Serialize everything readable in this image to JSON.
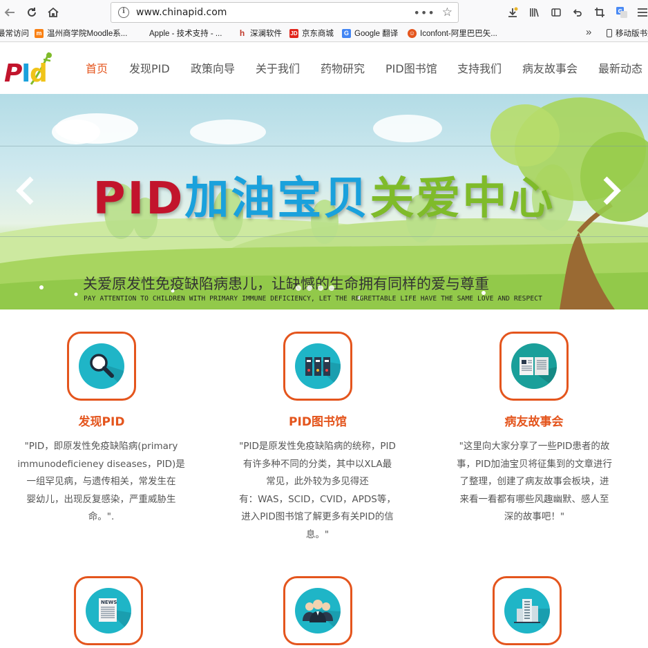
{
  "browser": {
    "url": "www.chinapid.com",
    "bookmarks": [
      {
        "label": "最常访问",
        "icon": "bookmark-star-icon"
      },
      {
        "label": "温州商学院Moodle系...",
        "icon": "moodle-icon",
        "color": "#f98012"
      },
      {
        "label": "Apple - 技术支持 - ...",
        "icon": "apple-icon",
        "color": "#333333"
      },
      {
        "label": "深澜软件",
        "icon": "srun-icon",
        "color": "#c0392b"
      },
      {
        "label": "京东商城",
        "icon": "jd-icon",
        "color": "#e1251b"
      },
      {
        "label": "Google 翻译",
        "icon": "google-translate-icon",
        "color": "#4285f4"
      },
      {
        "label": "Iconfont-阿里巴巴矢...",
        "icon": "iconfont-icon",
        "color": "#e4551d"
      },
      {
        "label": "移动版书签",
        "icon": "mobile-bookmarks-icon"
      }
    ]
  },
  "site": {
    "logo_text": "PID",
    "menu": [
      {
        "label": "首页",
        "active": true
      },
      {
        "label": "发现PID"
      },
      {
        "label": "政策向导"
      },
      {
        "label": "关于我们"
      },
      {
        "label": "药物研究"
      },
      {
        "label": "PID图书馆"
      },
      {
        "label": "支持我们"
      },
      {
        "label": "病友故事会"
      },
      {
        "label": "最新动态"
      }
    ]
  },
  "banner": {
    "title_red": "PID",
    "title_blue": "加油宝贝",
    "title_green": "关爱中心",
    "subtitle": "关爱原发性免疫缺陷病患儿，让缺憾的生命拥有同样的爱与尊重",
    "subtitle_en": "PAY ATTENTION TO CHILDREN WITH PRIMARY IMMUNE DEFICIENCY, LET THE REGRETTABLE LIFE HAVE THE SAME LOVE AND RESPECT"
  },
  "features": [
    {
      "title": "发现PID",
      "icon": "magnifier-icon",
      "lines": [
        "\"PID，即原发性免疫缺陷病(primary",
        "immunodeficieney diseases，PID)是",
        "一组罕见病，与遗传相关，常发生在",
        "婴幼儿，出现反复感染，严重威胁生",
        "命。\"."
      ]
    },
    {
      "title": "PID图书馆",
      "icon": "binders-icon",
      "lines": [
        "\"PID是原发性免疫缺陷病的统称，PID",
        "有许多种不同的分类，其中以XLA最",
        "常见，此外较为多见得还",
        "有：WAS，SCID，CVID，APDS等，",
        "进入PID图书馆了解更多有关PID的信",
        "息。\""
      ]
    },
    {
      "title": "病友故事会",
      "icon": "open-book-icon",
      "lines": [
        "\"这里向大家分享了一些PID患者的故",
        "事，PID加油宝贝将征集到的文章进行",
        "了整理，创建了病友故事会板块，进",
        "来看一看都有哪些风趣幽默、感人至",
        "深的故事吧！\""
      ]
    }
  ],
  "second_row_icons": [
    "newspaper-icon",
    "people-group-icon",
    "building-icon"
  ],
  "colors": {
    "accent": "#e4551d",
    "teal": "#1fb5c7"
  }
}
